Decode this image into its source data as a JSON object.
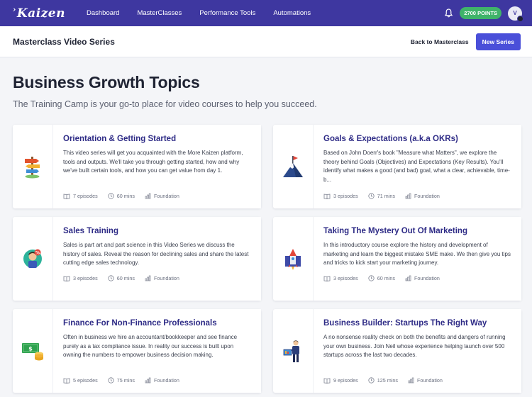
{
  "nav": {
    "logo": "Kaizen",
    "links": [
      "Dashboard",
      "MasterClasses",
      "Performance Tools",
      "Automations"
    ],
    "points": "2700 POINTS",
    "avatar_initial": "V"
  },
  "subheader": {
    "title": "Masterclass Video Series",
    "back_label": "Back to Masterclass",
    "new_series_label": "New Series"
  },
  "page": {
    "heading": "Business Growth Topics",
    "lead": "The Training Camp is your go-to place for video courses to help you succeed."
  },
  "cards": [
    {
      "title": "Orientation & Getting Started",
      "description": "This video series will get you acquainted with the More Kaizen platform, tools and outputs. We'll take you through getting started, how and why we've built certain tools, and how you can get value from day 1.",
      "episodes": "7 episodes",
      "duration": "60 mins",
      "level": "Foundation",
      "icon": "signpost-icon"
    },
    {
      "title": "Goals & Expectations (a.k.a OKRs)",
      "description": "Based on John Doerr's book \"Measure what Matters\", we explore the theory behind Goals (Objectives) and Expectations (Key Results). You'll identify what makes a good (and bad) goal, what a clear, achievable, time-b...",
      "episodes": "3 episodes",
      "duration": "71 mins",
      "level": "Foundation",
      "icon": "mountain-flag-icon"
    },
    {
      "title": "Sales Training",
      "description": "Sales is part art and part science in this Video Series we discuss the history of sales.  Reveal the reason for declining sales and share the latest cutting edge sales technology.",
      "episodes": "3 episodes",
      "duration": "60 mins",
      "level": "Foundation",
      "icon": "salesperson-icon"
    },
    {
      "title": "Taking The Mystery Out Of Marketing",
      "description": "In this introductory course explore the history and development of marketing and learn the biggest mistake SME make.  We then give you tips and tricks to kick start your marketing journey.",
      "episodes": "3 episodes",
      "duration": "60 mins",
      "level": "Foundation",
      "icon": "rocket-icon"
    },
    {
      "title": "Finance For Non-Finance Professionals",
      "description": "Often in business we hire an accountant/bookkeeper and see finance purely as a tax compliance issue.  In reality our success is built upon owning the numbers to empower business decision making.",
      "episodes": "5 episodes",
      "duration": "75 mins",
      "level": "Foundation",
      "icon": "money-icon"
    },
    {
      "title": "Business Builder: Startups The Right Way",
      "description": "A no nonsense reality check on both the benefits and dangers of running your own business.  Join Neil whose experience helping launch over 500 startups across the last two decades.",
      "episodes": "9 episodes",
      "duration": "125 mins",
      "level": "Foundation",
      "icon": "presenter-icon"
    }
  ],
  "colors": {
    "nav_bg": "#3e37a0",
    "accent": "#4a4fd9",
    "points_badge": "#3fb36a",
    "card_title": "#2e2b86"
  }
}
